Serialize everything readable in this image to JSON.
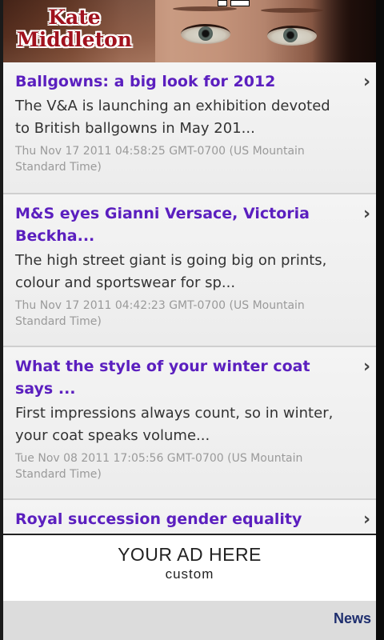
{
  "header": {
    "title_line1": "Kate",
    "title_line2": "Middleton"
  },
  "news": [
    {
      "headline": "Ballgowns: a big look for 2012",
      "summary": "The V&A is launching an exhibition devoted to British ballgowns in May 201...",
      "date": "Thu Nov 17 2011 04:58:25 GMT-0700 (US Mountain Standard Time)"
    },
    {
      "headline": "M&S eyes Gianni Versace, Victoria Beckha...",
      "summary": "The high street giant is going big on prints, colour and sportswear for sp...",
      "date": "Thu Nov 17 2011 04:42:23 GMT-0700 (US Mountain Standard Time)"
    },
    {
      "headline": "What the style of your winter coat says ...",
      "summary": "First impressions always count, so in winter, your coat speaks volume...",
      "date": "Tue Nov 08 2011 17:05:56 GMT-0700 (US Mountain Standard Time)"
    },
    {
      "headline": "Royal succession gender equality"
    }
  ],
  "ad": {
    "title": "YOUR AD HERE",
    "subtitle": "custom"
  },
  "tabbar": {
    "news_label": "News"
  },
  "colors": {
    "headline": "#5b1fbf",
    "title_red": "#a0121e",
    "tab_label": "#1e2e6e"
  },
  "icons": {
    "item_chevron": "chevron-right-icon"
  }
}
